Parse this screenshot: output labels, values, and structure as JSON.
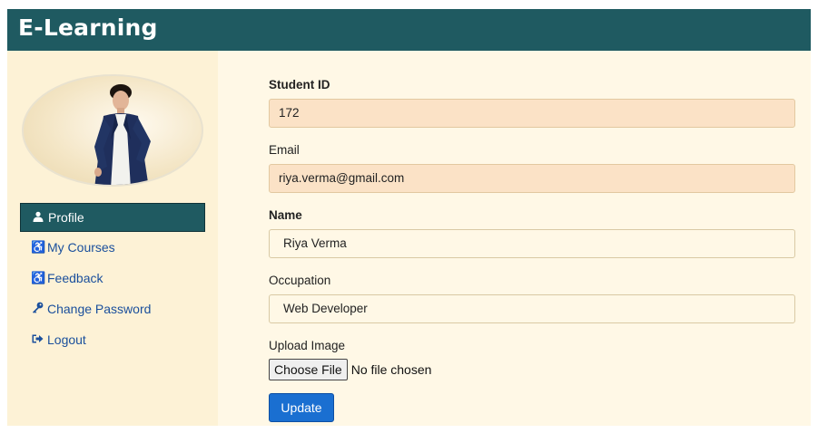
{
  "app": {
    "title": "E-Learning"
  },
  "sidebar": {
    "items": [
      {
        "label": "Profile",
        "icon": "user-icon",
        "active": true
      },
      {
        "label": "My Courses",
        "icon": "accessible-icon",
        "active": false
      },
      {
        "label": "Feedback",
        "icon": "accessible-icon",
        "active": false
      },
      {
        "label": "Change Password",
        "icon": "key-icon",
        "active": false
      },
      {
        "label": "Logout",
        "icon": "sign-out-icon",
        "active": false
      }
    ]
  },
  "form": {
    "student_id": {
      "label": "Student ID",
      "value": "172"
    },
    "email": {
      "label": "Email",
      "value": "riya.verma@gmail.com"
    },
    "name": {
      "label": "Name",
      "value": "Riya Verma"
    },
    "occupation": {
      "label": "Occupation",
      "value": "Web Developer"
    },
    "upload": {
      "label": "Upload Image",
      "button": "Choose File",
      "status": "No file chosen"
    },
    "submit_label": "Update"
  },
  "colors": {
    "header": "#1f5a61",
    "sidebar_bg": "#fdf2d6",
    "content_bg": "#fff8e6",
    "readonly_field": "#fbe2c6",
    "primary_button": "#1a6fd1",
    "nav_link": "#1a4f9c"
  }
}
